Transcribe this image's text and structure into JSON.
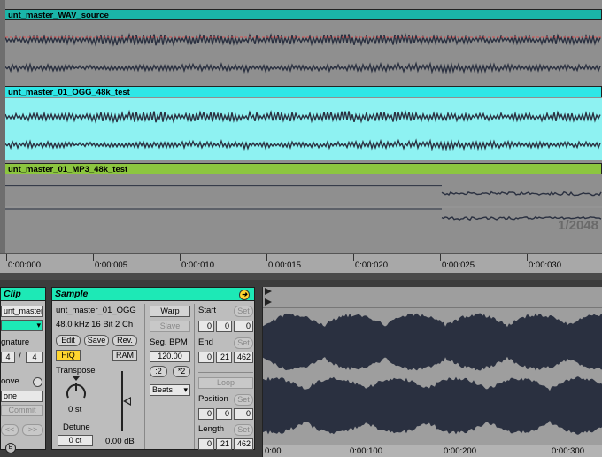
{
  "tracks": [
    {
      "name": "unt_master_WAV_source",
      "header_color": "#1ab5a8",
      "wave_bg": "#8f8f8f"
    },
    {
      "name": "unt_master_01_OGG_48k_test",
      "header_color": "#2ee6e6",
      "wave_bg": "#8ef2f2"
    },
    {
      "name": "unt_master_01_MP3_48k_test",
      "header_color": "#8cc63f",
      "wave_bg": "#8f8f8f"
    }
  ],
  "zoom": "1/2048",
  "ruler": [
    "0:00:000",
    "0:00:005",
    "0:00:010",
    "0:00:015",
    "0:00:020",
    "0:00:025",
    "0:00:030"
  ],
  "clip": {
    "title": "Clip",
    "name": "unt_master",
    "signature_label": "gnature",
    "sig_num": "4",
    "sig_den": "4",
    "groove_label": "oove",
    "groove_value": "one",
    "commit": "Commit",
    "prev": "<<",
    "next": ">>"
  },
  "sample": {
    "title": "Sample",
    "file": "unt_master_01_OGG",
    "info": "48.0 kHz 16 Bit 2 Ch",
    "edit": "Edit",
    "save": "Save",
    "rev": "Rev.",
    "hiq": "HiQ",
    "ram": "RAM",
    "transpose_label": "Transpose",
    "transpose_value": "0 st",
    "detune_label": "Detune",
    "detune_value": "0 ct",
    "gain_value": "0.00 dB",
    "warp": "Warp",
    "slave": "Slave",
    "bpm_label": "Seg. BPM",
    "bpm_value": "120.00",
    "half": ":2",
    "double": "*2",
    "mode": "Beats",
    "start_label": "Start",
    "set": "Set",
    "start": [
      "0",
      "0",
      "0"
    ],
    "end_label": "End",
    "end": [
      "0",
      "21",
      "462"
    ],
    "loop": "Loop",
    "position_label": "Position",
    "position": [
      "0",
      "0",
      "0"
    ],
    "length_label": "Length",
    "length": [
      "0",
      "21",
      "462"
    ]
  },
  "sample_ruler": [
    "0:00",
    "0:00:100",
    "0:00:200",
    "0:00:300"
  ],
  "colors": {
    "accent": "#1de9b6",
    "hiq": "#ffd52e",
    "waveform": "#2a3040"
  }
}
